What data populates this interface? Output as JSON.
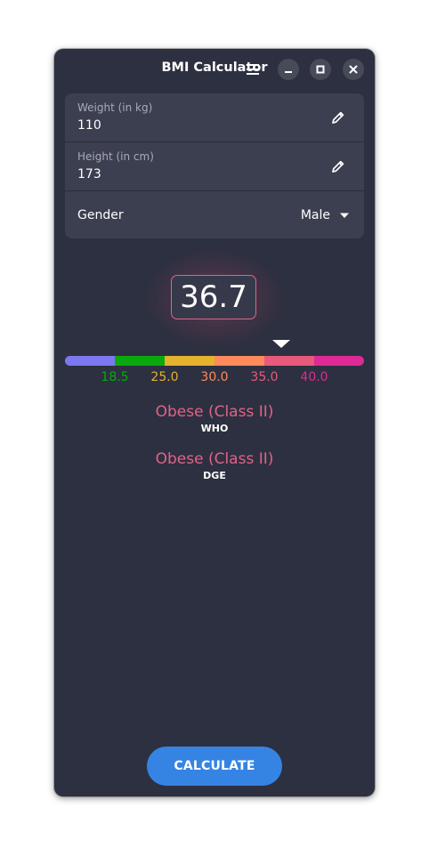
{
  "window": {
    "title": "BMI Calculator"
  },
  "icons": {
    "menu": "menu-icon",
    "minimize": "minimize-icon",
    "maximize": "maximize-icon",
    "close": "close-icon",
    "edit": "pencil-icon",
    "dropdown": "chevron-down-icon"
  },
  "form": {
    "weight": {
      "caption": "Weight (in kg)",
      "value": "110"
    },
    "height": {
      "caption": "Height (in cm)",
      "value": "173"
    },
    "gender": {
      "label": "Gender",
      "selected": "Male"
    }
  },
  "result": {
    "bmi": "36.7",
    "marker_value": 36.7,
    "scale": {
      "min": 15,
      "max": 45,
      "segments": [
        {
          "color": "#7b78f0"
        },
        {
          "color": "#0aa80f"
        },
        {
          "color": "#e5b22e"
        },
        {
          "color": "#ff8a5c"
        },
        {
          "color": "#e75a7c"
        },
        {
          "color": "#dd2a96"
        }
      ],
      "ticks": [
        {
          "label": "18.5",
          "color": "#0aa80f"
        },
        {
          "label": "25.0",
          "color": "#e5b22e"
        },
        {
          "label": "30.0",
          "color": "#ff8a5c"
        },
        {
          "label": "35.0",
          "color": "#e75a7c"
        },
        {
          "label": "40.0",
          "color": "#dd2a96"
        }
      ]
    },
    "classifications": [
      {
        "name": "Obese (Class II)",
        "standard": "WHO"
      },
      {
        "name": "Obese (Class II)",
        "standard": "DGE"
      }
    ]
  },
  "actions": {
    "calculate_label": "CALCULATE"
  },
  "colors": {
    "window_bg": "#2d3040",
    "card_bg": "#3c3f4f",
    "accent": "#3584e4",
    "result_accent": "#e06388"
  }
}
